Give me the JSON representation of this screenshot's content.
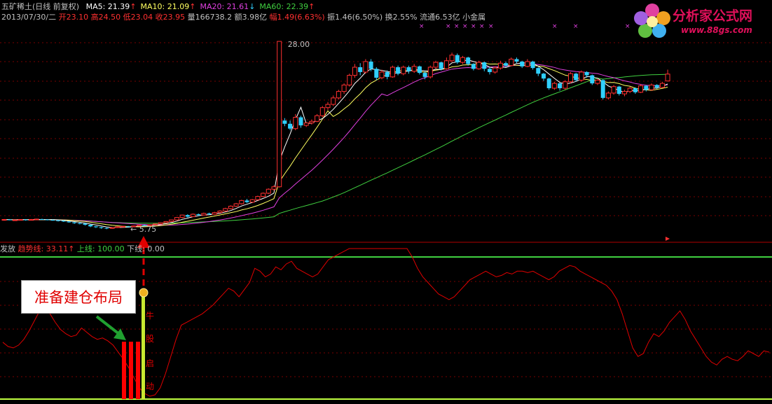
{
  "header": {
    "stock_name": "五矿稀土(日线 前复权)",
    "ma_labels": [
      {
        "text": "MA5: 21.39",
        "arrow": "↑",
        "color": "#ffffff"
      },
      {
        "text": "MA10: 21.09",
        "arrow": "↑",
        "color": "#ffff60"
      },
      {
        "text": "MA20: 21.61",
        "arrow": "↓",
        "color": "#e040e0"
      },
      {
        "text": "MA60: 22.39",
        "arrow": "↑",
        "color": "#40d040"
      }
    ],
    "quote": {
      "date": "2013/07/30/二",
      "open": "开23.10",
      "high": "高24.50",
      "low": "低23.04",
      "close": "收23.95",
      "volume": "量166738.2",
      "amount": "额3.98亿",
      "change": "幅1.49(6.63%)",
      "amplitude": "振1.46(6.50%)",
      "turnover": "换2.55%",
      "float": "流通6.53亿",
      "sector": "小金属"
    }
  },
  "indicator": {
    "name": "发放",
    "trend_label": "趋势线: 33.11",
    "trend_arrow": "↑",
    "upper_label": "上线: 100.00",
    "lower_label": "下线: 0.00"
  },
  "annotations": {
    "callout": "准备建仓布局",
    "price_high": "28.00",
    "price_low": "5.75",
    "signal_chars": [
      "牛",
      "股",
      "启",
      "动"
    ]
  },
  "logo": {
    "name": "分析家公式网",
    "url": "www.88gs.com"
  },
  "colors": {
    "up": "#ff3030",
    "down": "#30d0ff",
    "ma5": "#ffffff",
    "ma10": "#ffff60",
    "ma20": "#e040e0",
    "ma60": "#40d040",
    "trend": "#e00000",
    "upper": "#40d040",
    "lower": "#c0ff40",
    "bar": "#ff0000"
  },
  "chart_data": [
    {
      "type": "line",
      "title": "五矿稀土(日线 前复权)",
      "ylim": [
        4,
        30
      ],
      "candles": [
        [
          5.9,
          5.95,
          5.8,
          6.0
        ],
        [
          5.95,
          5.9,
          5.85,
          6.0
        ],
        [
          5.9,
          5.9,
          5.8,
          5.95
        ],
        [
          5.9,
          5.95,
          5.85,
          6.0
        ],
        [
          5.95,
          5.9,
          5.8,
          6.0
        ],
        [
          5.9,
          5.95,
          5.85,
          6.0
        ],
        [
          5.95,
          6.0,
          5.9,
          6.05
        ],
        [
          6.0,
          5.95,
          5.9,
          6.05
        ],
        [
          5.95,
          5.9,
          5.85,
          6.0
        ],
        [
          5.9,
          5.85,
          5.8,
          5.95
        ],
        [
          5.85,
          5.8,
          5.7,
          5.9
        ],
        [
          5.8,
          5.7,
          5.65,
          5.85
        ],
        [
          5.7,
          5.6,
          5.55,
          5.75
        ],
        [
          5.6,
          5.5,
          5.4,
          5.65
        ],
        [
          5.5,
          5.45,
          5.35,
          5.6
        ],
        [
          5.45,
          5.3,
          5.2,
          5.5
        ],
        [
          5.3,
          5.1,
          5.0,
          5.35
        ],
        [
          5.1,
          5.0,
          4.9,
          5.15
        ],
        [
          5.0,
          4.9,
          4.8,
          5.05
        ],
        [
          4.9,
          4.85,
          4.75,
          4.95
        ],
        [
          4.85,
          4.95,
          4.8,
          5.0
        ],
        [
          4.95,
          5.05,
          4.9,
          5.1
        ],
        [
          5.05,
          5.1,
          5.0,
          5.15
        ],
        [
          5.1,
          5.05,
          5.0,
          5.15
        ],
        [
          5.05,
          5.15,
          5.0,
          5.2
        ],
        [
          5.15,
          5.25,
          5.1,
          5.3
        ],
        [
          5.25,
          5.2,
          5.15,
          5.3
        ],
        [
          5.2,
          5.3,
          5.15,
          5.35
        ],
        [
          5.3,
          5.4,
          5.25,
          5.45
        ],
        [
          5.4,
          5.55,
          5.35,
          5.6
        ],
        [
          5.55,
          5.7,
          5.5,
          5.75
        ],
        [
          5.7,
          5.9,
          5.65,
          5.95
        ],
        [
          5.9,
          6.2,
          5.85,
          6.25
        ],
        [
          6.2,
          6.5,
          6.1,
          6.55
        ],
        [
          6.5,
          6.3,
          6.2,
          6.6
        ],
        [
          6.3,
          6.6,
          6.25,
          6.7
        ],
        [
          6.6,
          6.5,
          6.4,
          6.7
        ],
        [
          6.5,
          6.7,
          6.45,
          6.8
        ],
        [
          6.7,
          6.6,
          6.5,
          6.8
        ],
        [
          6.6,
          6.8,
          6.55,
          6.9
        ],
        [
          6.8,
          7.0,
          6.75,
          7.1
        ],
        [
          7.0,
          7.3,
          6.9,
          7.4
        ],
        [
          7.3,
          7.6,
          7.2,
          7.7
        ],
        [
          7.6,
          7.9,
          7.5,
          8.0
        ],
        [
          7.9,
          8.3,
          7.8,
          8.4
        ],
        [
          8.3,
          8.1,
          8.0,
          8.5
        ],
        [
          8.1,
          8.4,
          8.0,
          8.5
        ],
        [
          8.4,
          8.8,
          8.3,
          8.9
        ],
        [
          8.8,
          9.2,
          8.7,
          9.3
        ],
        [
          9.2,
          9.7,
          9.1,
          9.8
        ],
        [
          9.7,
          10.0,
          9.5,
          10.2
        ],
        [
          10.0,
          28.0,
          9.9,
          28.0
        ],
        [
          18.2,
          17.8,
          17.5,
          18.5
        ],
        [
          17.8,
          17.2,
          17.0,
          18.2
        ],
        [
          17.2,
          18.6,
          17.0,
          19.0
        ],
        [
          18.6,
          17.6,
          17.3,
          18.8
        ],
        [
          17.6,
          17.9,
          17.4,
          18.0
        ],
        [
          17.9,
          18.1,
          17.7,
          18.3
        ],
        [
          18.1,
          18.8,
          18.0,
          19.0
        ],
        [
          18.8,
          19.8,
          18.6,
          20.0
        ],
        [
          19.8,
          20.2,
          19.5,
          20.5
        ],
        [
          20.2,
          21.0,
          20.0,
          21.3
        ],
        [
          21.0,
          21.8,
          20.8,
          22.0
        ],
        [
          21.8,
          22.6,
          21.5,
          22.8
        ],
        [
          22.6,
          23.8,
          22.4,
          24.0
        ],
        [
          23.8,
          24.8,
          23.5,
          25.2
        ],
        [
          24.8,
          24.2,
          23.8,
          25.3
        ],
        [
          24.2,
          25.5,
          24.0,
          25.8
        ],
        [
          25.5,
          24.6,
          24.3,
          25.8
        ],
        [
          24.6,
          23.5,
          23.2,
          24.8
        ],
        [
          23.5,
          24.2,
          23.3,
          24.5
        ],
        [
          24.2,
          23.6,
          23.3,
          24.4
        ],
        [
          23.6,
          24.8,
          23.5,
          25.0
        ],
        [
          24.8,
          24.0,
          23.8,
          25.0
        ],
        [
          24.0,
          24.8,
          23.8,
          25.0
        ],
        [
          24.8,
          24.3,
          24.0,
          25.0
        ],
        [
          24.3,
          24.9,
          24.1,
          25.2
        ],
        [
          24.9,
          24.1,
          23.9,
          25.0
        ],
        [
          24.1,
          23.6,
          23.3,
          24.3
        ],
        [
          23.6,
          24.8,
          23.4,
          25.0
        ],
        [
          24.8,
          25.4,
          24.6,
          25.6
        ],
        [
          25.4,
          24.6,
          24.4,
          25.5
        ],
        [
          24.6,
          25.6,
          24.5,
          26.0
        ],
        [
          25.6,
          26.3,
          25.4,
          26.6
        ],
        [
          26.3,
          25.4,
          25.2,
          26.5
        ],
        [
          25.4,
          26.0,
          25.2,
          26.2
        ],
        [
          26.0,
          25.2,
          25.0,
          26.1
        ],
        [
          25.2,
          24.6,
          24.4,
          25.3
        ],
        [
          24.6,
          25.4,
          24.5,
          25.6
        ],
        [
          25.4,
          24.6,
          24.3,
          25.5
        ],
        [
          24.6,
          24.2,
          23.9,
          24.8
        ],
        [
          24.2,
          24.7,
          24.0,
          24.9
        ],
        [
          24.7,
          25.3,
          24.5,
          25.6
        ],
        [
          25.3,
          25.0,
          24.8,
          25.5
        ],
        [
          25.0,
          25.8,
          24.9,
          26.0
        ],
        [
          25.8,
          25.5,
          25.3,
          26.0
        ],
        [
          25.5,
          24.9,
          24.7,
          25.6
        ],
        [
          24.9,
          25.5,
          24.8,
          25.8
        ],
        [
          25.5,
          24.7,
          24.5,
          25.6
        ],
        [
          24.7,
          24.0,
          23.7,
          24.8
        ],
        [
          24.0,
          23.4,
          23.1,
          24.1
        ],
        [
          23.4,
          22.2,
          22.0,
          23.5
        ],
        [
          22.2,
          22.8,
          22.0,
          23.0
        ],
        [
          22.8,
          22.2,
          21.9,
          22.9
        ],
        [
          22.2,
          23.0,
          22.0,
          23.2
        ],
        [
          23.0,
          24.0,
          22.8,
          24.2
        ],
        [
          24.0,
          23.2,
          23.0,
          24.1
        ],
        [
          23.2,
          24.2,
          23.0,
          24.4
        ],
        [
          24.2,
          23.8,
          23.5,
          24.3
        ],
        [
          23.8,
          22.8,
          22.6,
          23.9
        ],
        [
          22.8,
          23.2,
          22.6,
          23.4
        ],
        [
          23.2,
          21.0,
          20.8,
          23.3
        ],
        [
          21.0,
          21.6,
          20.8,
          21.8
        ],
        [
          21.6,
          22.4,
          21.4,
          22.6
        ],
        [
          22.4,
          21.5,
          21.3,
          22.5
        ],
        [
          21.5,
          21.8,
          21.2,
          22.0
        ],
        [
          21.8,
          22.2,
          21.6,
          22.4
        ],
        [
          22.2,
          21.7,
          21.5,
          22.3
        ],
        [
          21.7,
          22.5,
          21.6,
          22.7
        ],
        [
          22.5,
          22.0,
          21.8,
          22.6
        ],
        [
          22.0,
          22.6,
          21.9,
          22.8
        ],
        [
          22.6,
          22.3,
          22.1,
          22.7
        ],
        [
          22.3,
          22.8,
          22.2,
          23.0
        ],
        [
          23.1,
          23.95,
          23.04,
          24.5
        ]
      ],
      "candle_fields": [
        "open",
        "close",
        "low",
        "high"
      ],
      "series": [
        {
          "name": "MA5",
          "last": 21.39
        },
        {
          "name": "MA10",
          "last": 21.09
        },
        {
          "name": "MA20",
          "last": 21.61
        },
        {
          "name": "MA60",
          "last": 22.39
        }
      ]
    },
    {
      "type": "line",
      "title": "发放",
      "ylim": [
        0,
        100
      ],
      "trend": [
        40,
        37,
        36,
        38,
        42,
        48,
        55,
        62,
        64,
        60,
        54,
        49,
        46,
        44,
        45,
        50,
        47,
        44,
        42,
        43,
        41,
        38,
        33,
        28,
        22,
        15,
        8,
        4,
        2,
        3,
        8,
        18,
        30,
        42,
        52,
        54,
        56,
        58,
        60,
        63,
        66,
        70,
        74,
        78,
        76,
        72,
        77,
        82,
        92,
        90,
        86,
        88,
        93,
        91,
        95,
        97,
        92,
        90,
        88,
        86,
        88,
        93,
        98,
        100,
        102,
        104,
        106,
        110,
        112,
        114,
        118,
        120,
        122,
        124,
        126,
        124,
        118,
        110,
        100,
        92,
        86,
        82,
        78,
        74,
        72,
        70,
        72,
        76,
        80,
        84,
        86,
        88,
        90,
        88,
        86,
        87,
        89,
        88,
        90,
        90,
        89,
        90,
        88,
        86,
        84,
        86,
        90,
        92,
        94,
        93,
        90,
        88,
        86,
        84,
        82,
        80,
        76,
        70,
        60,
        48,
        36,
        30,
        32,
        40,
        46,
        44,
        48,
        54,
        58,
        62,
        56,
        48,
        42,
        36,
        30,
        26,
        24,
        28,
        30,
        28,
        27,
        30,
        34,
        32,
        30,
        34,
        33
      ],
      "upper": 100,
      "lower": 0,
      "trend_last": 33.11
    }
  ]
}
